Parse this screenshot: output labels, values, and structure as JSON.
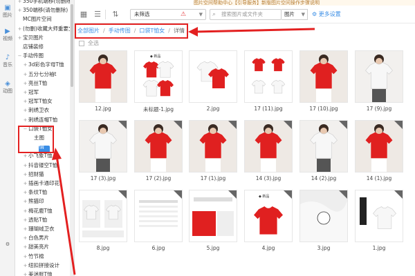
{
  "banner": "图片空间帮助中心【引导服务】新版图片空间操作步骤说明",
  "rail": {
    "items": [
      {
        "label": "图片",
        "icon": "image-icon"
      },
      {
        "label": "视频",
        "icon": "video-icon"
      },
      {
        "label": "音乐",
        "icon": "music-icon"
      },
      {
        "label": "动图",
        "icon": "gif-icon"
      }
    ]
  },
  "tree": {
    "items": [
      {
        "label": "350手机端移(勿删除",
        "toggle": "+"
      },
      {
        "label": "350端移(请勿删除)",
        "toggle": "+"
      },
      {
        "label": "MC图片空间",
        "toggle": ""
      },
      {
        "label": "(勿删)收藏大师重要文",
        "toggle": "+"
      },
      {
        "label": "宝贝图片",
        "toggle": "+"
      },
      {
        "label": "店铺装修",
        "toggle": ""
      },
      {
        "label": "手动传图",
        "toggle": "−"
      },
      {
        "label": "3d彩色字母T恤",
        "toggle": "+"
      },
      {
        "label": "五分七分袖t",
        "toggle": "+"
      },
      {
        "label": "亮丝T恤",
        "toggle": "+"
      },
      {
        "label": "冠军",
        "toggle": "+"
      },
      {
        "label": "冠军T恤女",
        "toggle": "+"
      },
      {
        "label": "刺绣卫衣",
        "toggle": "+"
      },
      {
        "label": "刺绣连帽T恤",
        "toggle": "+"
      },
      {
        "label": "口袋T恤女",
        "toggle": "−"
      },
      {
        "label": "主图",
        "toggle": ""
      },
      {
        "label": "详情",
        "toggle": ""
      },
      {
        "label": "小飞象T恤",
        "toggle": "+"
      },
      {
        "label": "抖音镂空T恤",
        "toggle": "+"
      },
      {
        "label": "招财猫",
        "toggle": "+"
      },
      {
        "label": "插画卡通印花",
        "toggle": "+"
      },
      {
        "label": "条纹T恤",
        "toggle": "+"
      },
      {
        "label": "熊猫印",
        "toggle": "+"
      },
      {
        "label": "梅花鹿T恤",
        "toggle": "+"
      },
      {
        "label": "透贴T恤",
        "toggle": "+"
      },
      {
        "label": "珊瑚绒卫衣",
        "toggle": "+"
      },
      {
        "label": "白色男片",
        "toggle": "+"
      },
      {
        "label": "甜美亮片",
        "toggle": "+"
      },
      {
        "label": "竹节棉",
        "toggle": "+"
      },
      {
        "label": "纽扣拼接设计",
        "toggle": "+"
      },
      {
        "label": "美迷胖T恤",
        "toggle": "+"
      }
    ]
  },
  "toolbar": {
    "filter": "未筛选",
    "search_placeholder": "搜索图片或文件夹",
    "scope": "图片",
    "more": "更多设置"
  },
  "breadcrumb": {
    "items": [
      "全部图片",
      "手动传图",
      "口袋T恤女"
    ],
    "current": "详情"
  },
  "root_label": "全选",
  "grid": [
    {
      "name": "12.jpg",
      "kind": "model-red"
    },
    {
      "name": "未标题-1.jpg",
      "kind": "flat-red-white"
    },
    {
      "name": "2.jpg",
      "kind": "flat-white-red"
    },
    {
      "name": "17 (11).jpg",
      "kind": "flat-red-grid"
    },
    {
      "name": "17 (10).jpg",
      "kind": "model-red"
    },
    {
      "name": "17 (9).jpg",
      "kind": "model-white"
    },
    {
      "name": "17 (3).jpg",
      "kind": "model-white"
    },
    {
      "name": "17 (2).jpg",
      "kind": "model-red"
    },
    {
      "name": "17 (1).jpg",
      "kind": "model-red"
    },
    {
      "name": "14 (3).jpg",
      "kind": "model-red"
    },
    {
      "name": "14 (2).jpg",
      "kind": "model-white"
    },
    {
      "name": "14 (1).jpg",
      "kind": "model-red"
    },
    {
      "name": "8.jpg",
      "kind": "size-chart"
    },
    {
      "name": "6.jpg",
      "kind": "spec-sheet"
    },
    {
      "name": "5.jpg",
      "kind": "detail-red"
    },
    {
      "name": "4.jpg",
      "kind": "brand-red"
    },
    {
      "name": "3.jpg",
      "kind": "fabric"
    },
    {
      "name": "1.jpg",
      "kind": "brand-white"
    }
  ]
}
